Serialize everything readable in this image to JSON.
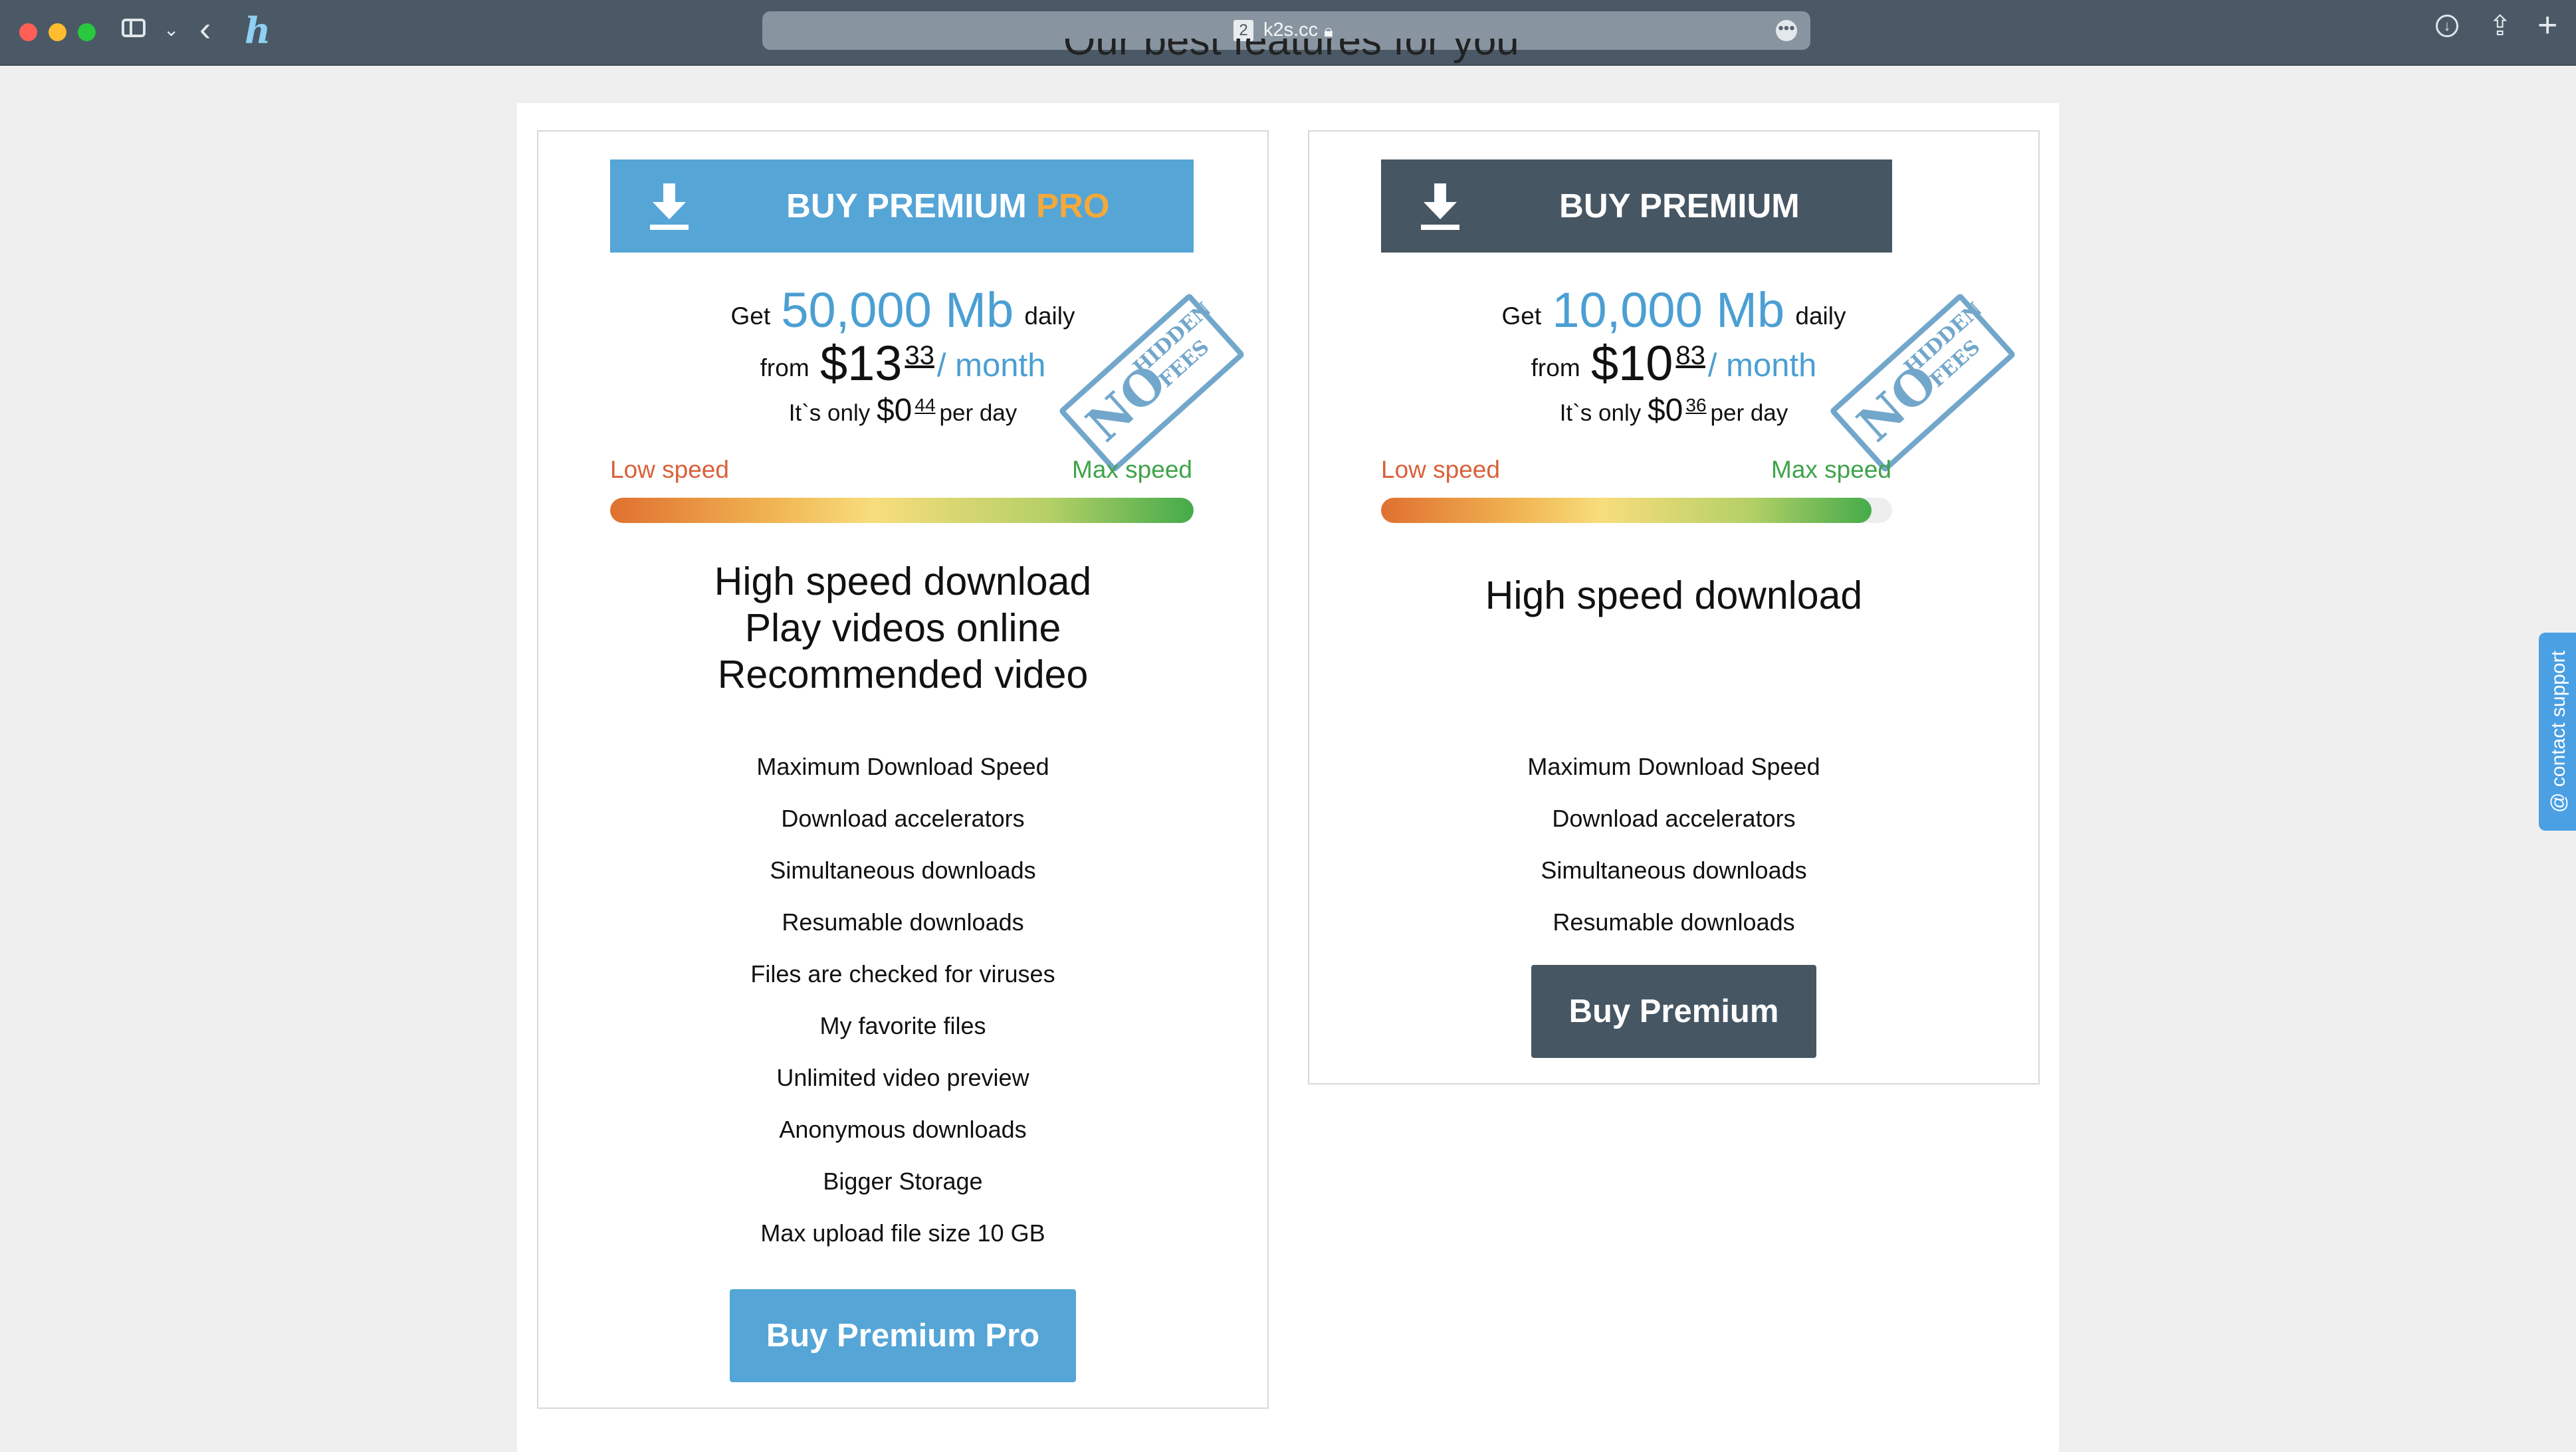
{
  "browser": {
    "tab_number": "2",
    "url": "k2s.cc",
    "more_glyph": "•••"
  },
  "page": {
    "section_heading": "Our best features for you"
  },
  "plans": {
    "pro": {
      "header_main": "BUY PREMIUM",
      "header_accent": "PRO",
      "get_prefix": "Get",
      "traffic": "50,000 Mb",
      "traffic_suffix": "daily",
      "from_prefix": "from",
      "price_dollars": "$13",
      "price_cents": "33",
      "per_month": "/ month",
      "day_prefix": "It`s only",
      "day_dollars": "$0",
      "day_cents": "44",
      "day_suffix": "per day",
      "stamp_no": "NO",
      "stamp_hidden": "HIDDEN",
      "stamp_fees": "FEES",
      "low_speed": "Low speed",
      "max_speed": "Max speed",
      "speed_level_percent": 100,
      "headlines": [
        "High speed download",
        "Play videos online",
        "Recommended video"
      ],
      "features": [
        "Maximum Download Speed",
        "Download accelerators",
        "Simultaneous downloads",
        "Resumable downloads",
        "Files are checked for viruses",
        "My favorite files",
        "Unlimited video preview",
        "Anonymous downloads",
        "Bigger Storage",
        "Max upload file size 10 GB"
      ],
      "buy_label": "Buy Premium Pro"
    },
    "premium": {
      "header_main": "BUY PREMIUM",
      "get_prefix": "Get",
      "traffic": "10,000 Mb",
      "traffic_suffix": "daily",
      "from_prefix": "from",
      "price_dollars": "$10",
      "price_cents": "83",
      "per_month": "/ month",
      "day_prefix": "It`s only",
      "day_dollars": "$0",
      "day_cents": "36",
      "day_suffix": "per day",
      "stamp_no": "NO",
      "stamp_hidden": "HIDDEN",
      "stamp_fees": "FEES",
      "low_speed": "Low speed",
      "max_speed": "Max speed",
      "speed_level_percent": 96,
      "headlines": [
        "High speed download"
      ],
      "features": [
        "Maximum Download Speed",
        "Download accelerators",
        "Simultaneous downloads",
        "Resumable downloads"
      ],
      "buy_label": "Buy Premium"
    }
  },
  "support": {
    "label": "@ contact support"
  },
  "colors": {
    "accent_blue": "#55a5d7",
    "dark_slate": "#465663",
    "pro_orange": "#f4a93a",
    "low_speed": "#d9603a",
    "max_speed": "#3ea34a"
  }
}
